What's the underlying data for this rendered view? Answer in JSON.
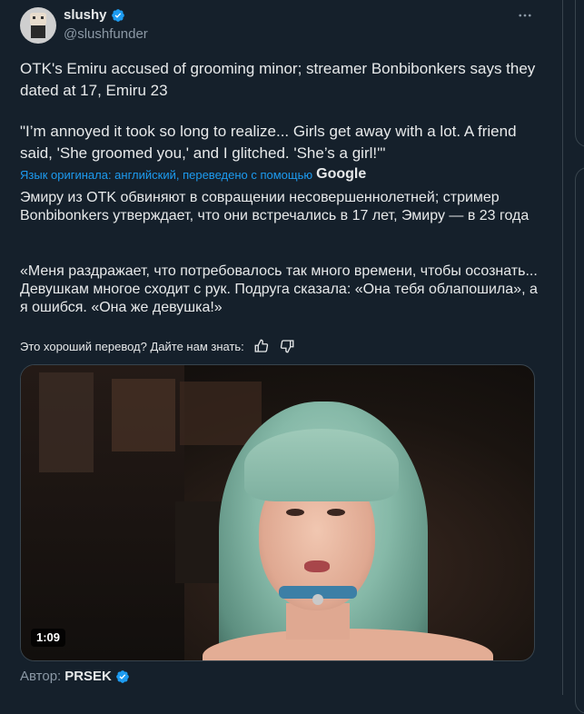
{
  "author": {
    "display_name": "slushy",
    "handle": "@slushfunder",
    "verified_icon": "verified-badge-icon",
    "avatar_icon": "avatar-image"
  },
  "tweet": {
    "text_main": "OTK's Emiru accused of grooming minor; streamer Bonbibonkers says they dated at 17, Emiru 23",
    "text_quote": "\"I’m annoyed it took so long to realize... Girls get away with a lot. A friend said, 'She groomed you,' and I glitched. 'She’s a girl!'\"",
    "translated_notice": "Язык оригинала: английский, переведено с помощью",
    "translation_provider": "Google",
    "translation_main": "Эмиру из OTK обвиняют в совращении несовершеннолетней; стример Bonbibonkers утверждает, что они встречались в 17 лет, Эмиру — в 23 года",
    "translation_quote": "«Меня раздражает, что потребовалось так много времени, чтобы осознать... Девушкам многое сходит с рук. Подруга сказала: «Она тебя облапошила», а я ошибся. «Она же девушка!»"
  },
  "feedback": {
    "prompt": "Это хороший перевод? Дайте нам знать:",
    "like_icon": "thumbs-up-icon",
    "dislike_icon": "thumbs-down-icon"
  },
  "media": {
    "duration": "1:09"
  },
  "attribution": {
    "label": "Автор:",
    "name": "PRSEK"
  },
  "colors": {
    "background": "#15202b",
    "accent": "#1d9bf0",
    "muted": "#8b98a5",
    "text": "#e7e9ea"
  }
}
